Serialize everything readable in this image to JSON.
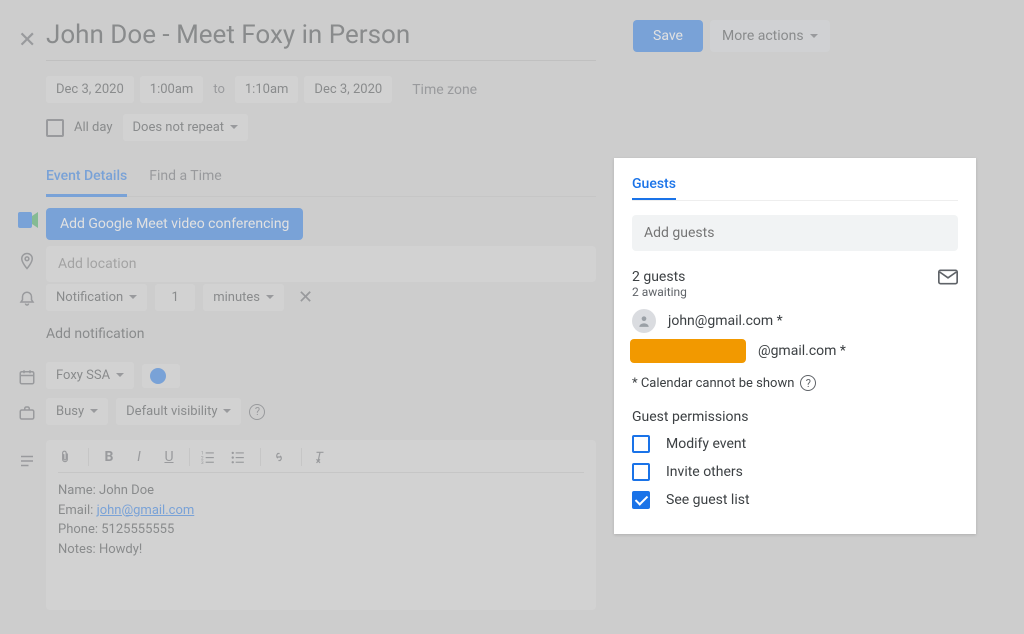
{
  "header": {
    "title": "John Doe - Meet Foxy in Person",
    "save_label": "Save",
    "more_actions_label": "More actions"
  },
  "date": {
    "start_date": "Dec 3, 2020",
    "start_time": "1:00am",
    "to": "to",
    "end_time": "1:10am",
    "end_date": "Dec 3, 2020",
    "timezone_label": "Time zone",
    "all_day_label": "All day",
    "repeat_label": "Does not repeat"
  },
  "tabs": {
    "event_details": "Event Details",
    "find_time": "Find a Time"
  },
  "actions": {
    "add_meet": "Add Google Meet video conferencing",
    "location_placeholder": "Add location",
    "notification_label": "Notification",
    "notification_value": "1",
    "notification_unit": "minutes",
    "add_notification": "Add notification",
    "calendar_label": "Foxy SSA",
    "busy_label": "Busy",
    "visibility_label": "Default visibility"
  },
  "description": {
    "name_label": "Name:",
    "name_value": "John Doe",
    "email_label": "Email:",
    "email_value": "john@gmail.com",
    "phone_label": "Phone:",
    "phone_value": "5125555555",
    "notes_label": "Notes:",
    "notes_value": "Howdy!"
  },
  "guests": {
    "title": "Guests",
    "add_placeholder": "Add guests",
    "count_label": "2 guests",
    "awaiting_label": "2 awaiting",
    "list": [
      {
        "email": "john@gmail.com *"
      },
      {
        "email": "@gmail.com *"
      }
    ],
    "calendar_note": "* Calendar cannot be shown",
    "permissions_title": "Guest permissions",
    "perm_modify": "Modify event",
    "perm_invite": "Invite others",
    "perm_see": "See guest list"
  }
}
